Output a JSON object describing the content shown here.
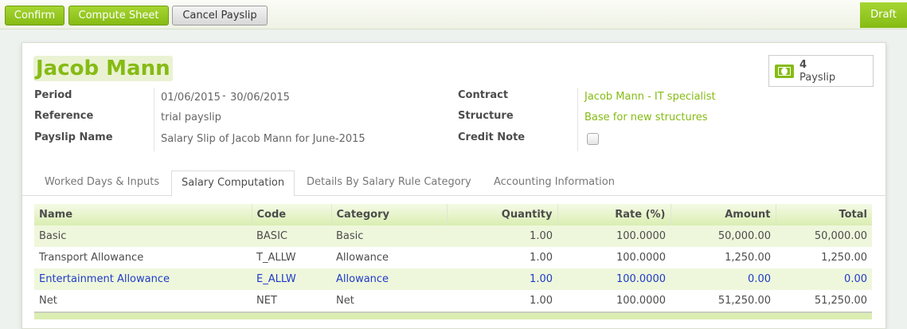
{
  "toolbar": {
    "confirm_label": "Confirm",
    "compute_label": "Compute Sheet",
    "cancel_label": "Cancel Payslip",
    "status": "Draft"
  },
  "employee": {
    "name": "Jacob Mann"
  },
  "smart_button": {
    "count": "4",
    "label": "Payslip"
  },
  "fields_left": {
    "period_label": "Period",
    "period_from": "01/06/2015",
    "period_sep": "-",
    "period_to": "30/06/2015",
    "reference_label": "Reference",
    "reference_value": "trial payslip",
    "payslip_name_label": "Payslip Name",
    "payslip_name_value": "Salary Slip of Jacob Mann for June-2015"
  },
  "fields_right": {
    "contract_label": "Contract",
    "contract_value": "Jacob Mann - IT specialist",
    "structure_label": "Structure",
    "structure_value": "Base for new structures",
    "credit_note_label": "Credit Note",
    "credit_note_checked": false
  },
  "tabs": [
    {
      "label": "Worked Days & Inputs",
      "active": false
    },
    {
      "label": "Salary Computation",
      "active": true
    },
    {
      "label": "Details By Salary Rule Category",
      "active": false
    },
    {
      "label": "Accounting Information",
      "active": false
    }
  ],
  "table": {
    "columns": [
      "Name",
      "Code",
      "Category",
      "Quantity",
      "Rate (%)",
      "Amount",
      "Total"
    ],
    "rows": [
      [
        "Basic",
        "BASIC",
        "Basic",
        "1.00",
        "100.0000",
        "50,000.00",
        "50,000.00"
      ],
      [
        "Transport Allowance",
        "T_ALLW",
        "Allowance",
        "1.00",
        "100.0000",
        "1,250.00",
        "1,250.00"
      ],
      [
        "Entertainment Allowance",
        "E_ALLW",
        "Allowance",
        "1.00",
        "100.0000",
        "0.00",
        "0.00"
      ],
      [
        "Net",
        "NET",
        "Net",
        "1.00",
        "100.0000",
        "51,250.00",
        "51,250.00"
      ]
    ]
  },
  "colors": {
    "accent": "#86bb14",
    "link_blue": "#1f3bc8"
  }
}
